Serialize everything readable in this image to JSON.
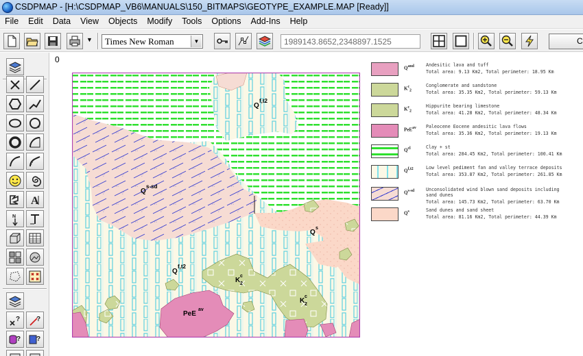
{
  "window": {
    "title": "CSDPMAP - [H:\\CSDPMAP_VB6\\MANUALS\\150_BITMAPS\\GEOTYPE_EXAMPLE.MAP [Ready]]"
  },
  "menu": {
    "items": [
      {
        "label": "File"
      },
      {
        "label": "Edit"
      },
      {
        "label": "Data"
      },
      {
        "label": "View"
      },
      {
        "label": "Objects"
      },
      {
        "label": "Modify"
      },
      {
        "label": "Tools"
      },
      {
        "label": "Options"
      },
      {
        "label": "Add-Ins"
      },
      {
        "label": "Help"
      }
    ]
  },
  "toolbar": {
    "font_name": "Times New Roman",
    "coordinates": "1989143.8652,2348897.1525",
    "cancel_label": "Ca",
    "icons": [
      "new-icon",
      "open-icon",
      "save-icon",
      "print-icon",
      "key-icon",
      "node-edit-icon",
      "layers-icon",
      "grid-icon",
      "frame-icon",
      "zoom-in-icon",
      "zoom-out-icon",
      "redraw-icon"
    ]
  },
  "canvas": {
    "origin_label": "0"
  },
  "map": {
    "labels": {
      "qft2_top": "Q",
      "qft2_top_sup": "f,t2",
      "qssd": "Q",
      "qssd_sup": "s-sd",
      "qs": "Q",
      "qs_sup": "s",
      "qft2_mid": "Q",
      "qft2_mid_sup": "f,t2",
      "k2_a": "K",
      "k2_a_sup": "c",
      "k2_a_sub": "2",
      "k2_b": "K",
      "k2_b_sup": "c",
      "k2_b_sub": "2",
      "pee": "PeE",
      "pee_sup": "av"
    },
    "colors": {
      "frame": "#b040b0",
      "andesitic": "#e8a0c0",
      "conglomerate": "#ccd89a",
      "lava": "#e48cb8",
      "clay_stripe": "#2ee02e",
      "pediment_bg": "#fbf8e6",
      "pediment_stripe": "#7ee0ea",
      "windblown_bg": "#f6dcd4",
      "windblown_mark": "#3038d0",
      "sand_sheet": "#fbd8c8"
    }
  },
  "legend": {
    "items": [
      {
        "code": "Q",
        "sup": "and",
        "desc": "Andesitic lava and tuff",
        "stats": "Total area: 9.13 Km2, Total perimeter: 18.95 Km",
        "swatch": "andesitic"
      },
      {
        "code": "K",
        "sup": "c",
        "sub": "2",
        "desc": "Conglomerate and sandstone",
        "stats": "Total area: 35.35 Km2, Total perimeter: 59.13 Km",
        "swatch": "conglomerate"
      },
      {
        "code": "K",
        "sup": "c",
        "sub": "2",
        "desc": "Hippurite bearing limestone",
        "stats": "Total area: 41.28 Km2, Total perimeter: 48.34 Km",
        "swatch": "conglomerate"
      },
      {
        "code": "PeE",
        "sup": "av",
        "desc": "Paleocene Eocene andesitic lava flows",
        "stats": "Total area: 35.36 Km2, Total perimeter: 19.13 Km",
        "swatch": "lava"
      },
      {
        "code": "Q",
        "sup": "cl",
        "desc": "Clay + st",
        "stats": "Total area: 284.45 Km2, Total perimeter: 100.41 Km",
        "swatch": "clay"
      },
      {
        "code": "Q",
        "sup": "f,t2",
        "desc": "Low level pediment fan and valley terrace deposits",
        "stats": "Total area: 353.87 Km2, Total perimeter: 261.85 Km",
        "swatch": "pediment"
      },
      {
        "code": "Q",
        "sup": "s-sd",
        "desc": "Unconsolidated wind blown sand deposits including",
        "desc2": "sand dunes",
        "stats": "Total area: 145.73 Km2, Total perimeter: 63.70 Km",
        "swatch": "windblown"
      },
      {
        "code": "Q",
        "sup": "s",
        "desc": "Sand dunes and sand sheet",
        "stats": "Total area: 81.16 Km2, Total perimeter: 44.39 Km",
        "swatch": "sand"
      }
    ]
  }
}
